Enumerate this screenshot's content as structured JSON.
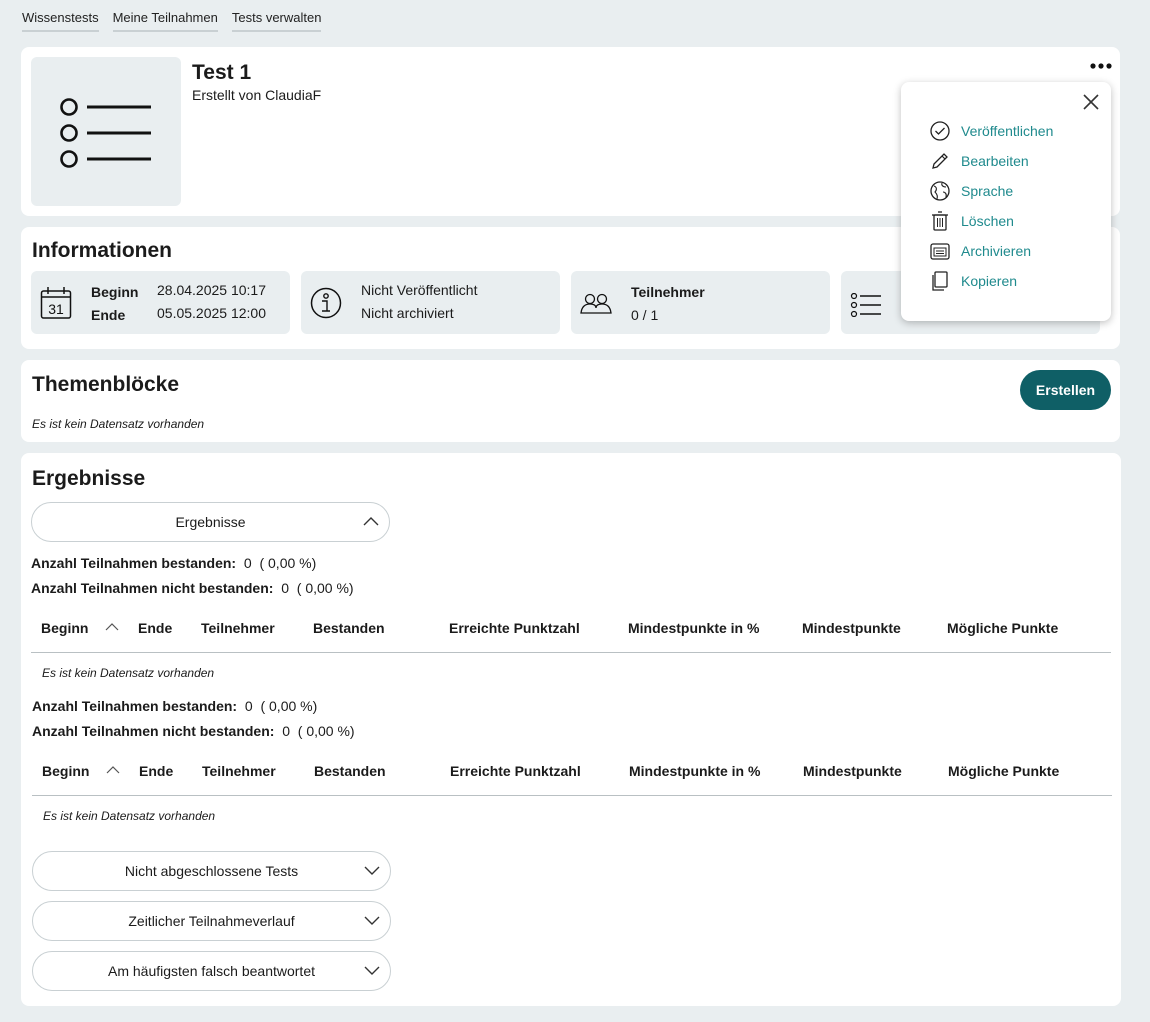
{
  "nav": [
    "Wissenstests",
    "Meine Teilnahmen",
    "Tests verwalten"
  ],
  "header": {
    "title": "Test 1",
    "author": "Erstellt von ClaudiaF",
    "thumbnail_icon": "list-icon",
    "more_icon": "more-horizontal-icon"
  },
  "menu": {
    "items": [
      {
        "label": "Veröffentlichen",
        "icon": "check-circle-icon"
      },
      {
        "label": "Bearbeiten",
        "icon": "pencil-icon"
      },
      {
        "label": "Sprache",
        "icon": "globe-icon"
      },
      {
        "label": "Löschen",
        "icon": "trash-icon"
      },
      {
        "label": "Archivieren",
        "icon": "archive-icon"
      },
      {
        "label": "Kopieren",
        "icon": "copy-icon"
      }
    ],
    "accent": "#1f8a8d"
  },
  "info": {
    "title": "Informationen",
    "begin_label": "Beginn",
    "end_label": "Ende",
    "begin_value": "28.04.2025 10:17",
    "end_value": "05.05.2025 12:00",
    "calendar_day": "31",
    "status_published": "Nicht Veröffentlicht",
    "status_archived": "Nicht archiviert",
    "participants_label": "Teilnehmer",
    "participants_value": "0 / 1"
  },
  "blocks": {
    "title": "Themenblöcke",
    "create_label": "Erstellen",
    "empty": "Es ist kein Datensatz vorhanden",
    "button_color": "#0f5f66"
  },
  "results": {
    "title": "Ergebnisse",
    "accordion_label": "Ergebnisse",
    "passed_label": "Anzahl Teilnahmen bestanden:",
    "passed_value": "0",
    "passed_pct": "( 0,00 %)",
    "failed_label": "Anzahl Teilnahmen nicht bestanden:",
    "failed_value": "0",
    "failed_pct": "( 0,00 %)",
    "columns": [
      "Beginn",
      "Ende",
      "Teilnehmer",
      "Bestanden",
      "Erreichte Punktzahl",
      "Mindestpunkte in %",
      "Mindestpunkte",
      "Mögliche Punkte"
    ],
    "empty": "Es ist kein Datensatz vorhanden",
    "accordions": [
      "Nicht abgeschlossene Tests",
      "Zeitlicher Teilnahmeverlauf",
      "Am häufigsten falsch beantwortet"
    ]
  }
}
